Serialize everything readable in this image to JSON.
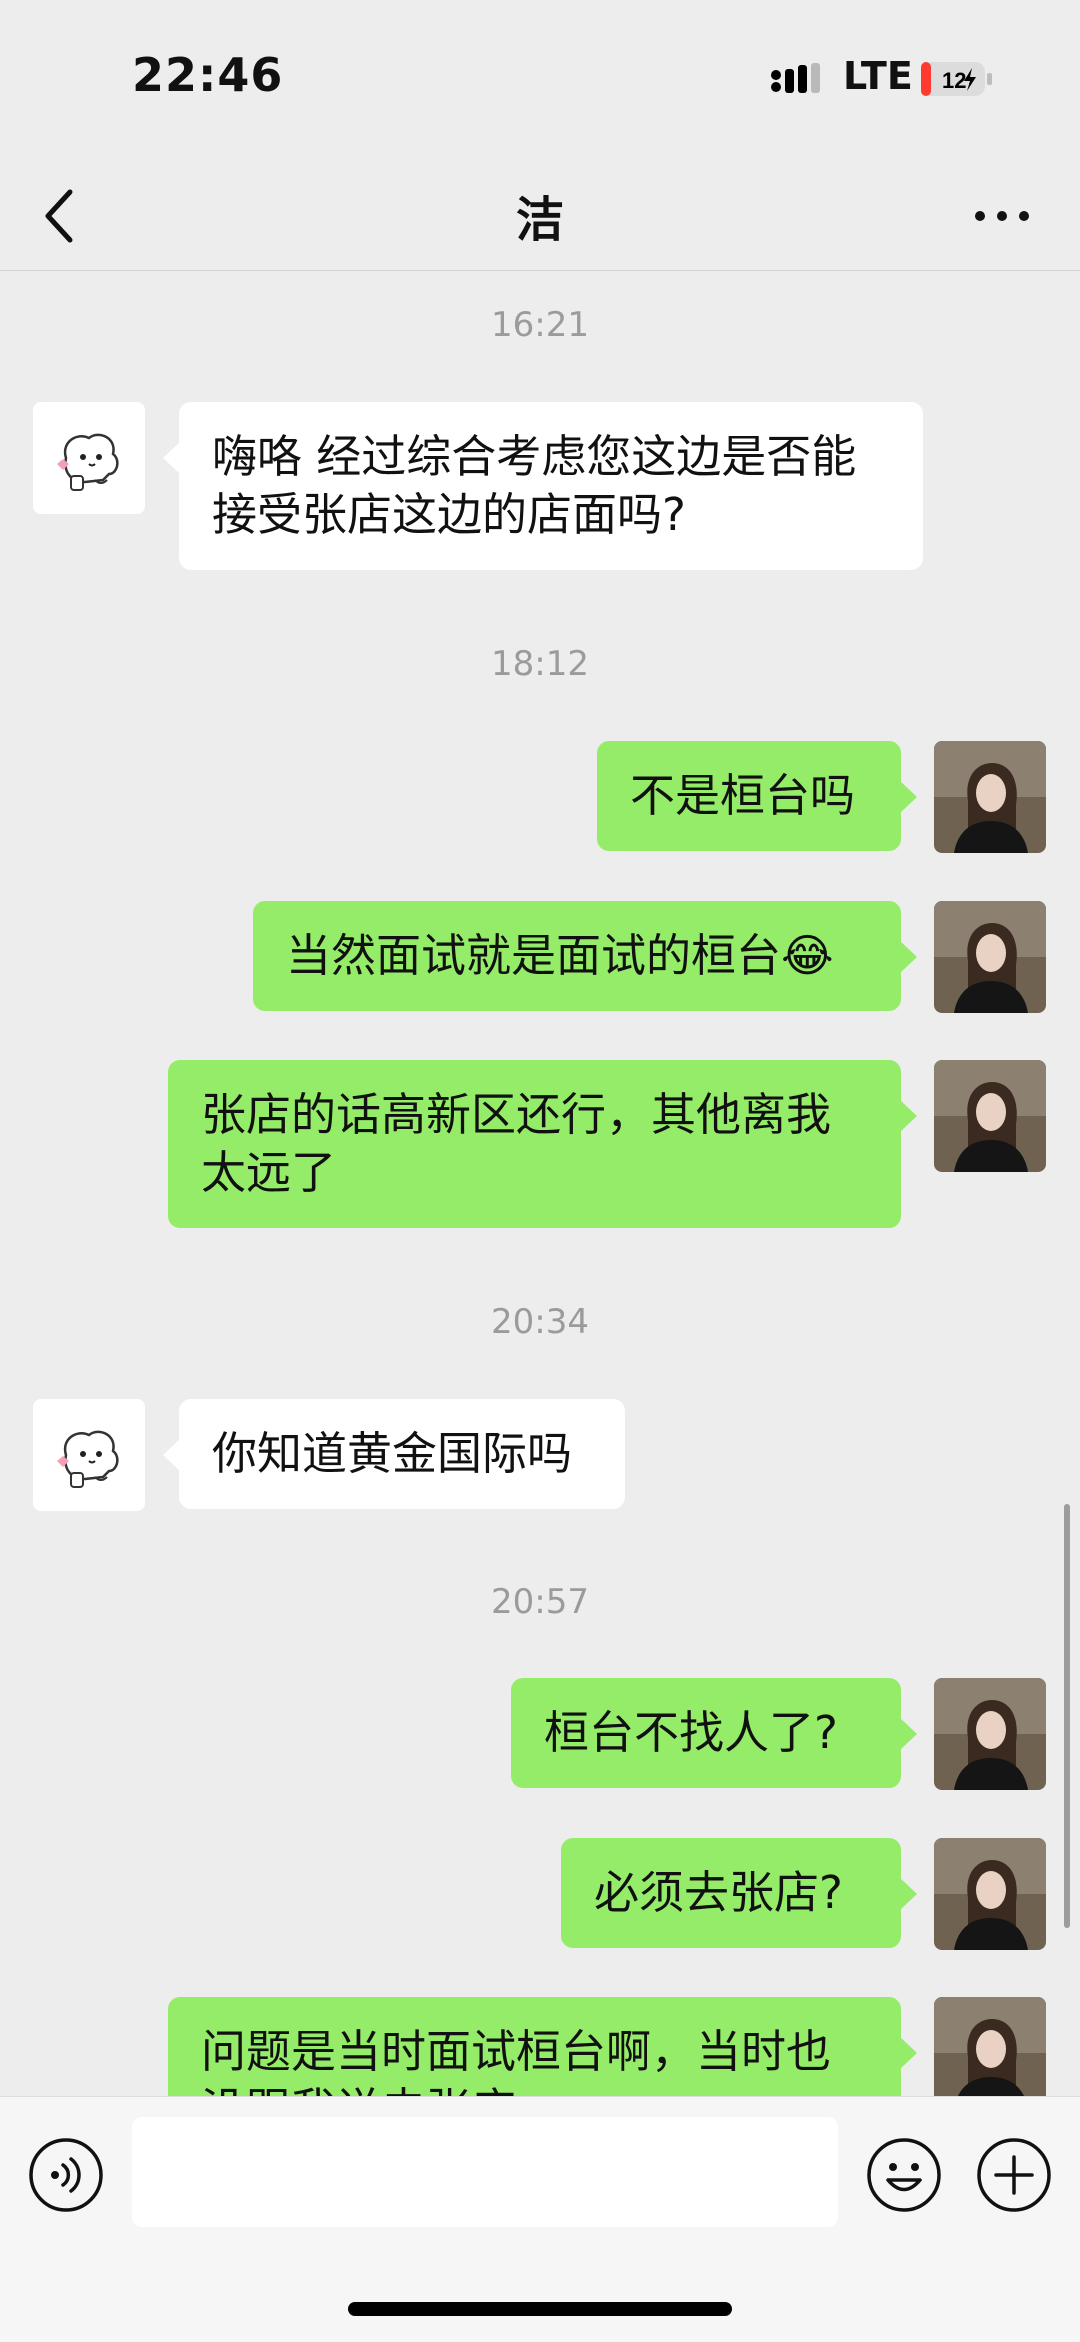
{
  "status_bar": {
    "time": "22:46",
    "network": "LTE",
    "battery": "12"
  },
  "header": {
    "title": "洁"
  },
  "messages": [
    {
      "type": "timestamp",
      "text": "16:21"
    },
    {
      "type": "message",
      "side": "left",
      "text": "嗨咯 经过综合考虑您这边是否能接受张店这边的店面吗?"
    },
    {
      "type": "timestamp",
      "text": "18:12"
    },
    {
      "type": "message",
      "side": "right",
      "text": "不是桓台吗"
    },
    {
      "type": "message",
      "side": "right",
      "text": "当然面试就是面试的桓台😂"
    },
    {
      "type": "message",
      "side": "right",
      "text": "张店的话高新区还行，其他离我太远了"
    },
    {
      "type": "timestamp",
      "text": "20:34"
    },
    {
      "type": "message",
      "side": "left",
      "text": "你知道黄金国际吗"
    },
    {
      "type": "timestamp",
      "text": "20:57"
    },
    {
      "type": "message",
      "side": "right",
      "text": "桓台不找人了?"
    },
    {
      "type": "message",
      "side": "right",
      "text": "必须去张店?"
    },
    {
      "type": "message",
      "side": "right",
      "text": "问题是当时面试桓台啊，当时也没跟我说去张店"
    }
  ],
  "input": {
    "value": "",
    "placeholder": ""
  },
  "colors": {
    "sent_bubble": "#95ec69",
    "received_bubble": "#ffffff",
    "background": "#ededed"
  },
  "icons": {
    "back": "chevron-left-icon",
    "more": "more-horizontal-icon",
    "voice": "voice-icon",
    "emoji": "emoji-icon",
    "plus": "plus-circle-icon"
  }
}
